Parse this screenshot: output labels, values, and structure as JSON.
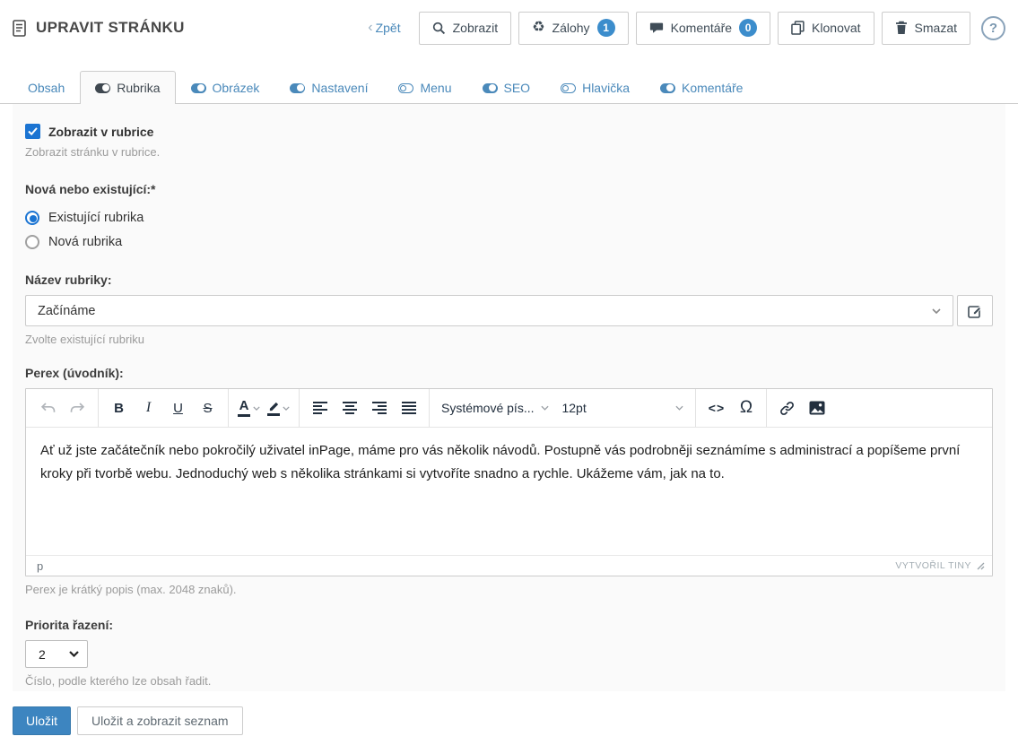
{
  "header": {
    "title": "UPRAVIT STRÁNKU",
    "back": {
      "chevron": "‹",
      "label": "Zpět"
    },
    "buttons": [
      {
        "label": "Zobrazit",
        "icon": "search-icon"
      },
      {
        "label": "Zálohy",
        "icon": "recycle-icon",
        "badge": "1"
      },
      {
        "label": "Komentáře",
        "icon": "comment-icon",
        "badge": "0"
      },
      {
        "label": "Klonovat",
        "icon": "clone-icon"
      },
      {
        "label": "Smazat",
        "icon": "trash-icon"
      }
    ],
    "help_label": "?"
  },
  "tabs": [
    {
      "label": "Obsah",
      "icon": "none",
      "active": false
    },
    {
      "label": "Rubrika",
      "icon": "toggle-on",
      "active": true
    },
    {
      "label": "Obrázek",
      "icon": "toggle-on",
      "active": false
    },
    {
      "label": "Nastavení",
      "icon": "toggle-on",
      "active": false
    },
    {
      "label": "Menu",
      "icon": "toggle-off",
      "active": false
    },
    {
      "label": "SEO",
      "icon": "toggle-on",
      "active": false
    },
    {
      "label": "Hlavička",
      "icon": "toggle-off",
      "active": false
    },
    {
      "label": "Komentáře",
      "icon": "toggle-on",
      "active": false
    }
  ],
  "form": {
    "show_in_category": {
      "label": "Zobrazit v rubrice",
      "checked": true,
      "help": "Zobrazit stránku v rubrice."
    },
    "new_or_existing": {
      "label": "Nová nebo existující:*",
      "options": [
        {
          "label": "Existující rubrika",
          "selected": true
        },
        {
          "label": "Nová rubrika",
          "selected": false
        }
      ]
    },
    "category_name": {
      "label": "Název rubriky:",
      "value": "Začínáme",
      "help": "Zvolte existující rubriku"
    },
    "perex": {
      "label": "Perex (úvodník):",
      "help": "Perex je krátký popis (max. 2048 znaků)."
    },
    "priority": {
      "label": "Priorita řazení:",
      "value": "2",
      "help": "Číslo, podle kterého lze obsah řadit."
    }
  },
  "editor": {
    "toolbar": {
      "bold": "B",
      "italic": "I",
      "underline": "U",
      "strikethrough": "S",
      "forecolor_letter": "A",
      "font_family": "Systémové pís...",
      "font_size": "12pt",
      "code": "<>",
      "charmap": "Ω"
    },
    "content": "Ať už jste začátečník nebo pokročilý uživatel inPage, máme pro vás několik návodů. Postupně vás podrobněji seznámíme s administrací a popíšeme první kroky při tvorbě webu. Jednoduchý web s několika stránkami si vytvoříte snadno a rychle. Ukážeme vám, jak na to.",
    "element_path": "p",
    "brand": "VYTVOŘIL TINY"
  },
  "footer": {
    "save": "Uložit",
    "save_and_list": "Uložit a zobrazit seznam"
  },
  "colors": {
    "accent_blue": "#4a89ba",
    "control_blue": "#1b74d2",
    "badge_blue": "#3c8dcc",
    "save_button": "#3d85c0",
    "toolbar_icon": "#222f3e"
  }
}
